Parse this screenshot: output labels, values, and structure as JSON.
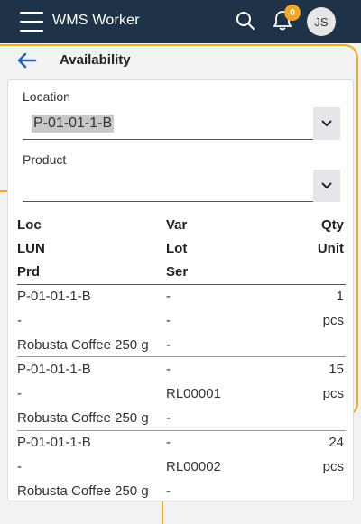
{
  "appbar": {
    "title": "WMS Worker",
    "notifications": "0",
    "avatar_initials": "JS"
  },
  "page": {
    "title": "Availability"
  },
  "form": {
    "location_label": "Location",
    "location_value": "P-01-01-1-B",
    "product_label": "Product",
    "product_value": ""
  },
  "table": {
    "headers": {
      "col1": [
        "Loc",
        "LUN",
        "Prd"
      ],
      "col2": [
        "Var",
        "Lot",
        "Ser"
      ],
      "col3": [
        "Qty",
        "Unit"
      ]
    },
    "rows": [
      {
        "loc": "P-01-01-1-B",
        "var": "-",
        "qty": "1",
        "lun": "-",
        "lot": "-",
        "unit": "pcs",
        "prd": "Robusta Coffee 250 g",
        "ser": "-"
      },
      {
        "loc": "P-01-01-1-B",
        "var": "-",
        "qty": "15",
        "lun": "-",
        "lot": "RL00001",
        "unit": "pcs",
        "prd": "Robusta Coffee 250 g",
        "ser": "-"
      },
      {
        "loc": "P-01-01-1-B",
        "var": "-",
        "qty": "24",
        "lun": "-",
        "lot": "RL00002",
        "unit": "pcs",
        "prd": "Robusta Coffee 250 g",
        "ser": "-"
      }
    ]
  },
  "colors": {
    "appbar": "#1e3347",
    "accent": "#f5a623",
    "back_arrow": "#1f5fbf"
  },
  "icons": [
    "menu-icon",
    "search-icon",
    "bell-icon",
    "back-arrow-icon",
    "chevron-down-icon"
  ]
}
